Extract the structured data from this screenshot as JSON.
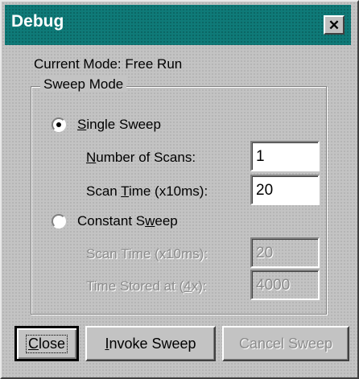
{
  "window": {
    "title": "Debug",
    "close_glyph": "✕"
  },
  "status": {
    "current_mode": "Current Mode: Free Run"
  },
  "sweep_mode": {
    "group_label": "Sweep Mode",
    "single": {
      "label_u": "S",
      "label_rest": "ingle Sweep",
      "selected": true,
      "number_of_scans_label_u": "N",
      "number_of_scans_label_rest": "umber of Scans:",
      "number_of_scans_value": "1",
      "scan_time_label_pre": "Scan ",
      "scan_time_label_u": "T",
      "scan_time_label_rest": "ime (x10ms):",
      "scan_time_value": "20"
    },
    "constant": {
      "label_pre": "Constant S",
      "label_u": "w",
      "label_rest": "eep",
      "selected": false,
      "scan_time_label": "Scan Time (x10ms):",
      "scan_time_value": "20",
      "time_stored_label_pre": "Time Stored at (",
      "time_stored_label_u": "4",
      "time_stored_label_rest": "x):",
      "time_stored_value": "4000"
    }
  },
  "buttons": {
    "close_u": "C",
    "close_rest": "lose",
    "invoke_u": "I",
    "invoke_rest": "nvoke Sweep",
    "cancel": "Cancel Sweep"
  }
}
